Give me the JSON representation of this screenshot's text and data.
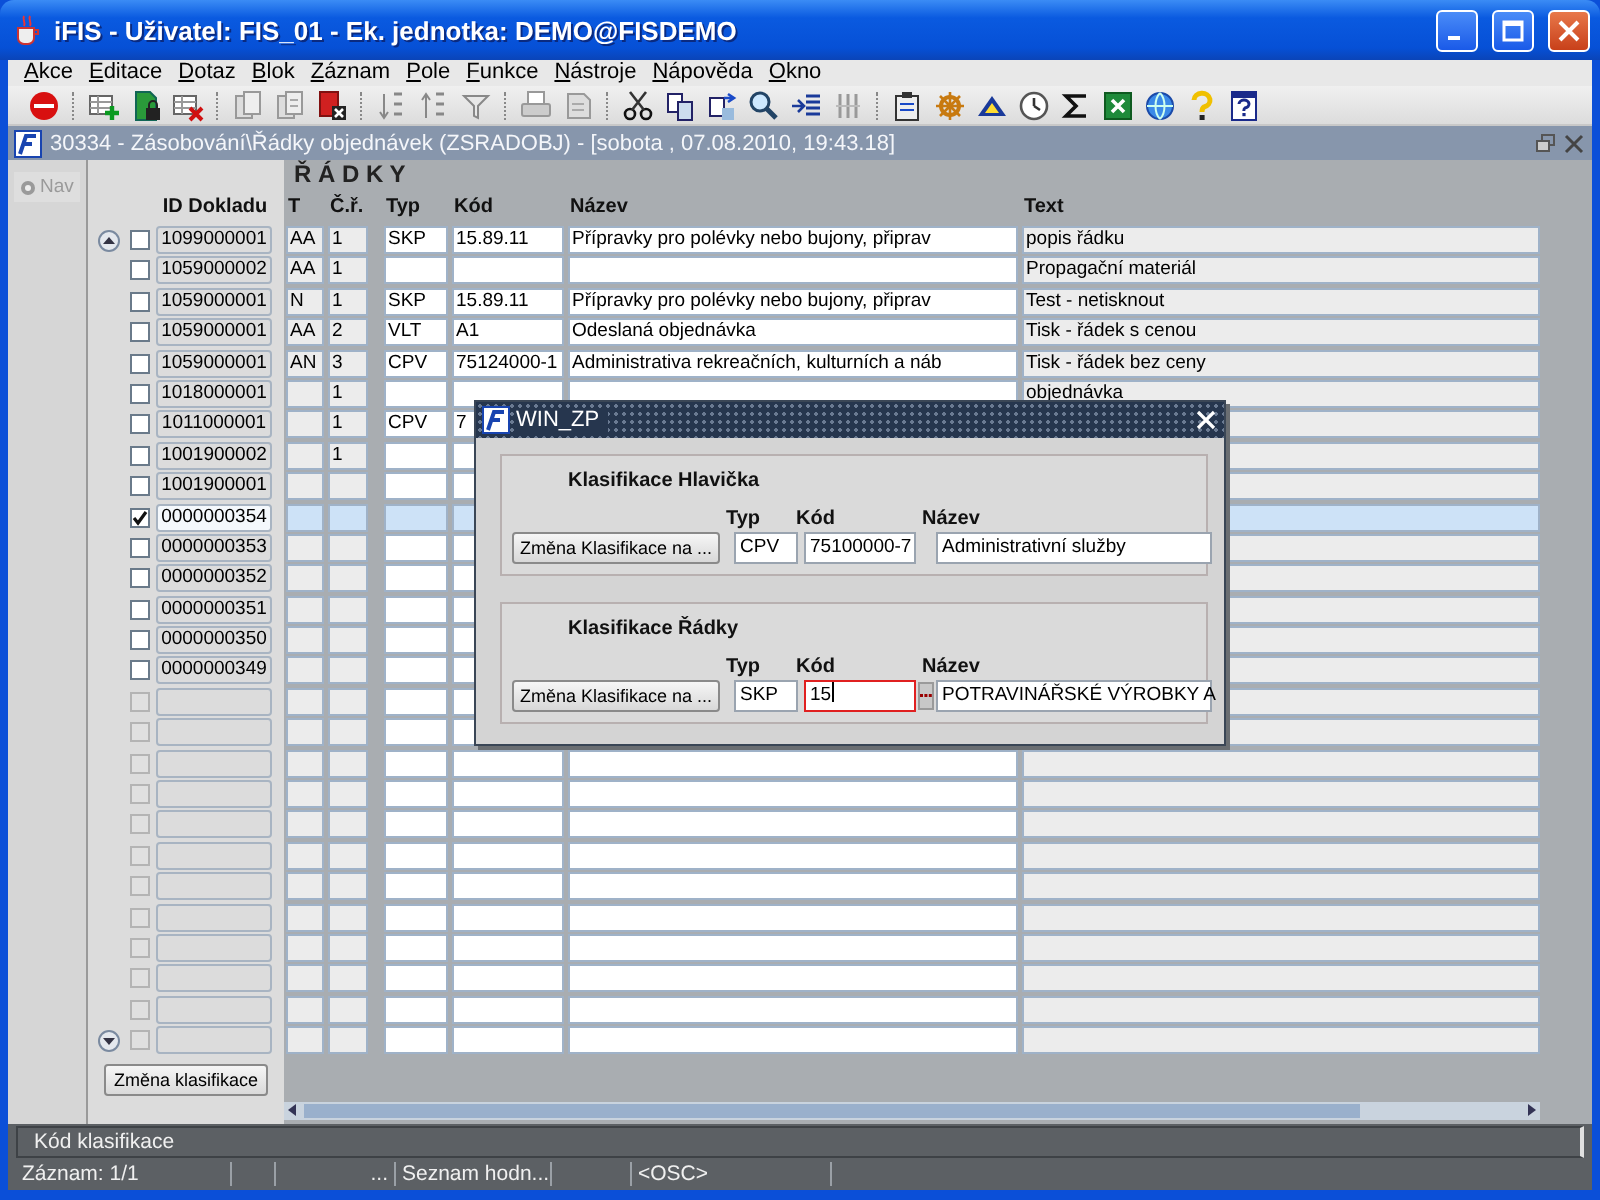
{
  "window": {
    "title": "iFIS - Uživatel: FIS_01 - Ek. jednotka: DEMO@FISDEMO"
  },
  "menu": [
    {
      "label": "Akce"
    },
    {
      "label": "Editace"
    },
    {
      "label": "Dotaz"
    },
    {
      "label": "Blok"
    },
    {
      "label": "Záznam"
    },
    {
      "label": "Pole"
    },
    {
      "label": "Funkce"
    },
    {
      "label": "Nástroje"
    },
    {
      "label": "Nápověda"
    },
    {
      "label": "Okno"
    }
  ],
  "form_window": {
    "title": "30334 - Zásobování\\Řádky objednávek (ZSRADOBJ) - [sobota , 07.08.2010, 19:43.18]",
    "active": false
  },
  "nav_button": {
    "label": "Nav",
    "disabled": true
  },
  "block": {
    "title": "Ř Á D K Y",
    "columns": [
      "ID Dokladu",
      "T",
      "Č.ř.",
      "Typ",
      "Kód",
      "Název",
      "Text"
    ],
    "rows": [
      {
        "kind": "record",
        "checked": false,
        "selected": false,
        "id": "1099000001",
        "t": "AA",
        "line": "1",
        "typ": "SKP",
        "kod": "15.89.11",
        "nazev": "Přípravky pro polévky nebo bujony, připrav",
        "text": "popis řádku"
      },
      {
        "kind": "record",
        "checked": false,
        "selected": false,
        "id": "1059000002",
        "t": "AA",
        "line": "1",
        "text": "Propagační materiál"
      },
      {
        "kind": "record",
        "checked": false,
        "selected": false,
        "id": "1059000001",
        "t": "N",
        "line": "1",
        "typ": "SKP",
        "kod": "15.89.11",
        "nazev": "Přípravky pro polévky nebo bujony, připrav",
        "text": "Test - netisknout"
      },
      {
        "kind": "record",
        "checked": false,
        "selected": false,
        "id": "1059000001",
        "t": "AA",
        "line": "2",
        "typ": "VLT",
        "kod": "A1",
        "nazev": "Odeslaná objednávka",
        "text": "Tisk - řádek s cenou"
      },
      {
        "kind": "record",
        "checked": false,
        "selected": false,
        "id": "1059000001",
        "t": "AN",
        "line": "3",
        "typ": "CPV",
        "kod": "75124000-1",
        "nazev": "Administrativa rekreačních, kulturních a náb",
        "text": "Tisk - řádek bez ceny"
      },
      {
        "kind": "record",
        "checked": false,
        "selected": false,
        "id": "1018000001",
        "line": "1",
        "text": "objednávka"
      },
      {
        "kind": "record",
        "checked": false,
        "selected": false,
        "id": "1011000001",
        "line": "1",
        "typ": "CPV",
        "kod": "7"
      },
      {
        "kind": "record",
        "checked": false,
        "selected": false,
        "id": "1001900002",
        "line": "1"
      },
      {
        "kind": "record",
        "checked": false,
        "selected": false,
        "id": "1001900001"
      },
      {
        "kind": "record",
        "checked": true,
        "selected": true,
        "id": "0000000354"
      },
      {
        "kind": "record",
        "checked": false,
        "selected": false,
        "id": "0000000353"
      },
      {
        "kind": "record",
        "checked": false,
        "selected": false,
        "id": "0000000352"
      },
      {
        "kind": "record",
        "checked": false,
        "selected": false,
        "id": "0000000351"
      },
      {
        "kind": "record",
        "checked": false,
        "selected": false,
        "id": "0000000350"
      },
      {
        "kind": "record",
        "checked": false,
        "selected": false,
        "id": "0000000349"
      },
      {
        "kind": "blank",
        "checked": false,
        "disabled": true
      },
      {
        "kind": "blank",
        "checked": false,
        "disabled": true
      },
      {
        "kind": "blank",
        "checked": false,
        "disabled": true
      },
      {
        "kind": "blank",
        "checked": false,
        "disabled": true
      },
      {
        "kind": "blank",
        "checked": false,
        "disabled": true
      },
      {
        "kind": "blank",
        "checked": false,
        "disabled": true
      },
      {
        "kind": "blank",
        "checked": false,
        "disabled": true
      },
      {
        "kind": "blank",
        "checked": false,
        "disabled": true
      },
      {
        "kind": "blank",
        "checked": false,
        "disabled": true
      },
      {
        "kind": "blank",
        "checked": false,
        "disabled": true
      },
      {
        "kind": "blank",
        "checked": false,
        "disabled": true
      },
      {
        "kind": "blank",
        "checked": false,
        "disabled": true
      }
    ]
  },
  "bottom_button": "Změna klasifikace",
  "dialog": {
    "title": "WIN_ZP",
    "groups": [
      {
        "title": "Klasifikace Hlavička",
        "button": "Změna Klasifikace na ...",
        "labels": [
          "Typ",
          "Kód",
          "Název"
        ],
        "lov": false,
        "fields": [
          {
            "value": "CPV",
            "focused": false
          },
          {
            "value": "75100000-7",
            "focused": false
          },
          {
            "value": "Administrativní služby",
            "focused": false
          }
        ]
      },
      {
        "title": "Klasifikace Řádky",
        "button": "Změna Klasifikace na ...",
        "labels": [
          "Typ",
          "Kód",
          "Název"
        ],
        "lov": true,
        "fields": [
          {
            "value": "SKP",
            "focused": false
          },
          {
            "value": "15",
            "focused": true
          },
          {
            "value": "POTRAVINÁŘSKÉ VÝROBKY A",
            "focused": false
          }
        ]
      }
    ]
  },
  "status": {
    "hint": "Kód klasifikace",
    "record": "Záznam: 1/1",
    "more": "...",
    "list": "Seznam hodn...",
    "mode": "<OSC>"
  }
}
